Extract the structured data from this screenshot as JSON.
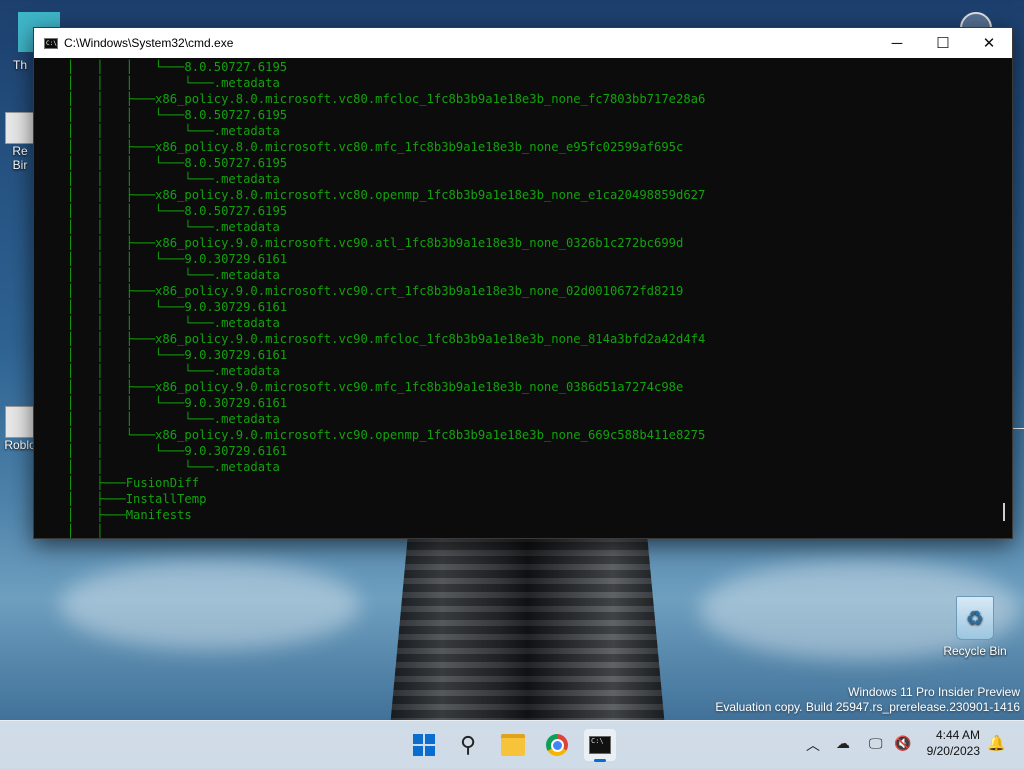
{
  "window": {
    "title": "C:\\Windows\\System32\\cmd.exe",
    "minimize_icon": "minimize-icon",
    "maximize_icon": "maximize-icon",
    "close_icon": "close-icon"
  },
  "console_lines": [
    "│   │   │   └───8.0.50727.6195",
    "│   │   │       └───.metadata",
    "│   │   ├───x86_policy.8.0.microsoft.vc80.mfcloc_1fc8b3b9a1e18e3b_none_fc7803bb717e28a6",
    "│   │   │   └───8.0.50727.6195",
    "│   │   │       └───.metadata",
    "│   │   ├───x86_policy.8.0.microsoft.vc80.mfc_1fc8b3b9a1e18e3b_none_e95fc02599af695c",
    "│   │   │   └───8.0.50727.6195",
    "│   │   │       └───.metadata",
    "│   │   ├───x86_policy.8.0.microsoft.vc80.openmp_1fc8b3b9a1e18e3b_none_e1ca20498859d627",
    "│   │   │   └───8.0.50727.6195",
    "│   │   │       └───.metadata",
    "│   │   ├───x86_policy.9.0.microsoft.vc90.atl_1fc8b3b9a1e18e3b_none_0326b1c272bc699d",
    "│   │   │   └───9.0.30729.6161",
    "│   │   │       └───.metadata",
    "│   │   ├───x86_policy.9.0.microsoft.vc90.crt_1fc8b3b9a1e18e3b_none_02d0010672fd8219",
    "│   │   │   └───9.0.30729.6161",
    "│   │   │       └───.metadata",
    "│   │   ├───x86_policy.9.0.microsoft.vc90.mfcloc_1fc8b3b9a1e18e3b_none_814a3bfd2a42d4f4",
    "│   │   │   └───9.0.30729.6161",
    "│   │   │       └───.metadata",
    "│   │   ├───x86_policy.9.0.microsoft.vc90.mfc_1fc8b3b9a1e18e3b_none_0386d51a7274c98e",
    "│   │   │   └───9.0.30729.6161",
    "│   │   │       └───.metadata",
    "│   │   └───x86_policy.9.0.microsoft.vc90.openmp_1fc8b3b9a1e18e3b_none_669c588b411e8275",
    "│   │       └───9.0.30729.6161",
    "│   │           └───.metadata",
    "│   ├───FusionDiff",
    "│   ├───InstallTemp",
    "│   ├───Manifests",
    "│   │"
  ],
  "desktop": {
    "recycle_bin_label": "Recycle Bin",
    "left_icon_1_label": "Th",
    "left_icon_2_label": "Re\nBir",
    "left_icon_3_label": "Roblo"
  },
  "watermark": {
    "line1": "Windows 11 Pro Insider Preview",
    "line2": "Evaluation copy. Build 25947.rs_prerelease.230901-1416"
  },
  "taskbar": {
    "time": "4:44 AM",
    "date": "9/20/2023",
    "icons": [
      "windows-start-icon",
      "search-icon",
      "file-explorer-icon",
      "chrome-icon",
      "command-prompt-icon"
    ]
  }
}
